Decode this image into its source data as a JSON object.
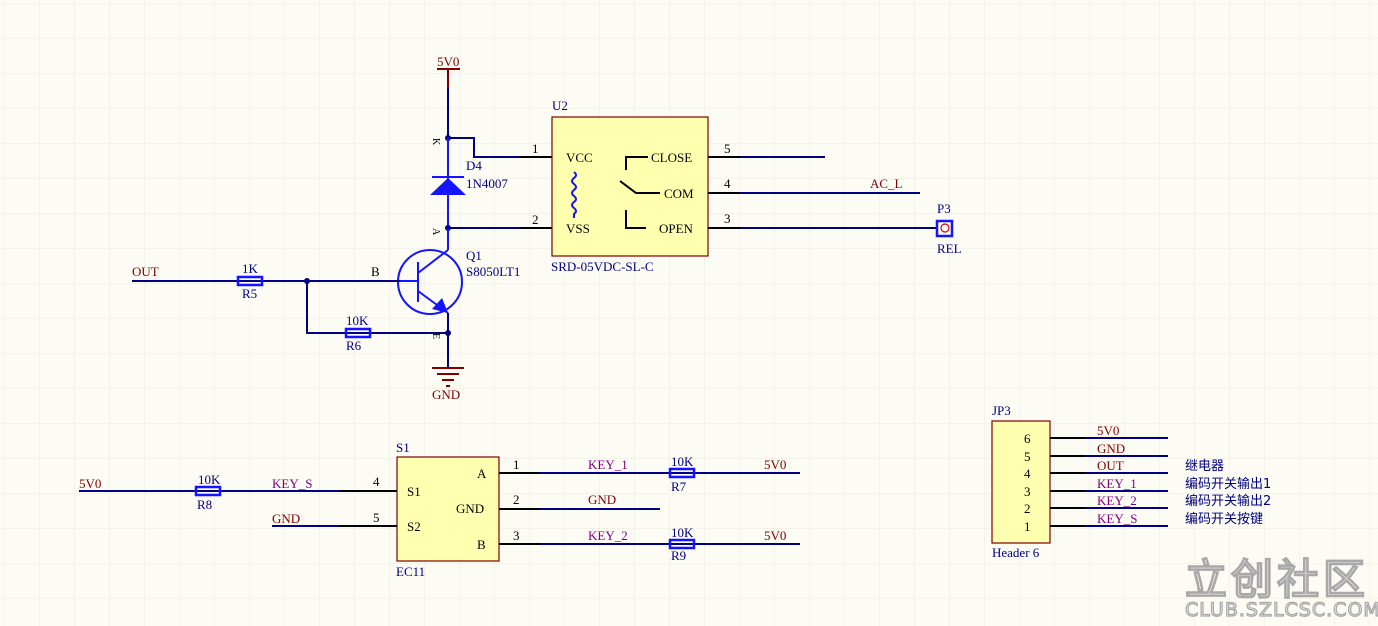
{
  "relay_section": {
    "power_5v": "5V0",
    "ground": "GND",
    "diode": {
      "designator": "D4",
      "value": "1N4007",
      "pin_k": "K",
      "pin_a": "A"
    },
    "transistor": {
      "designator": "Q1",
      "value": "S8050LT1",
      "pin_b": "B",
      "pin_e": "E"
    },
    "input_net": "OUT",
    "r5": {
      "designator": "R5",
      "value": "1K"
    },
    "r6": {
      "designator": "R6",
      "value": "10K"
    },
    "relay": {
      "designator": "U2",
      "part": "SRD-05VDC-SL-C",
      "pins": [
        {
          "num": "1",
          "name": "VCC"
        },
        {
          "num": "2",
          "name": "VSS"
        },
        {
          "num": "5",
          "name": "CLOSE"
        },
        {
          "num": "4",
          "name": "COM"
        },
        {
          "num": "3",
          "name": "OPEN"
        }
      ]
    },
    "com_net": "AC_L",
    "connector": {
      "designator": "P3",
      "value": "REL"
    }
  },
  "encoder_section": {
    "encoder": {
      "designator": "S1",
      "part": "EC11",
      "pins": [
        {
          "num": "4",
          "name": "S1"
        },
        {
          "num": "5",
          "name": "S2"
        },
        {
          "num": "1",
          "name": "A"
        },
        {
          "num": "2",
          "name": "GND"
        },
        {
          "num": "3",
          "name": "B"
        }
      ]
    },
    "left_power": "5V0",
    "r8": {
      "designator": "R8",
      "value": "10K"
    },
    "key_s_net": "KEY_S",
    "s2_net": "GND",
    "key1_net": "KEY_1",
    "gnd_net": "GND",
    "key2_net": "KEY_2",
    "r7": {
      "designator": "R7",
      "value": "10K",
      "power": "5V0"
    },
    "r9": {
      "designator": "R9",
      "value": "10K",
      "power": "5V0"
    }
  },
  "header": {
    "designator": "JP3",
    "part": "Header 6",
    "pins": [
      {
        "num": "6",
        "net": "5V0",
        "note": ""
      },
      {
        "num": "5",
        "net": "GND",
        "note": ""
      },
      {
        "num": "4",
        "net": "OUT",
        "note": "继电器"
      },
      {
        "num": "3",
        "net": "KEY_1",
        "note": "编码开关输出1"
      },
      {
        "num": "2",
        "net": "KEY_2",
        "note": "编码开关输出2"
      },
      {
        "num": "1",
        "net": "KEY_S",
        "note": "编码开关按键"
      }
    ]
  },
  "watermark": {
    "logo": "立创社区",
    "url": "CLUB.SZLCSC.COM"
  },
  "colors": {
    "wire": "#000080",
    "power": "#800000",
    "net_label": "#800080",
    "component": "#1414ff",
    "body_fill": "#ffffb0",
    "background": "#fcfbf4"
  }
}
